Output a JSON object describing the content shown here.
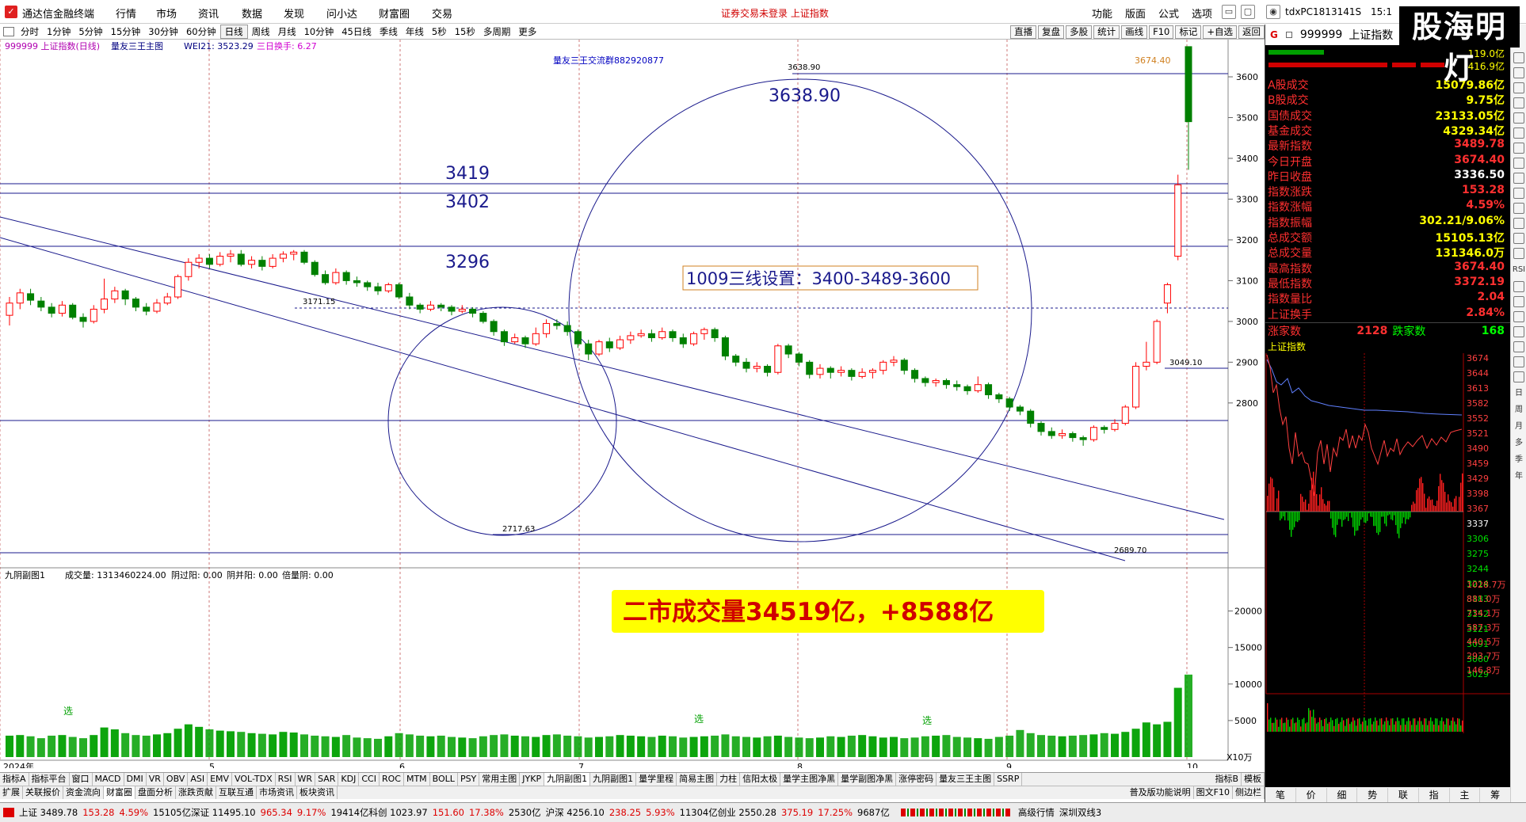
{
  "window": {
    "app_title": "通达信金融终端",
    "menus": [
      "行情",
      "市场",
      "资讯",
      "数据",
      "发现",
      "问小达",
      "财富圈",
      "交易"
    ],
    "notice": "证券交易未登录  上证指数",
    "right_menus": [
      "功能",
      "版面",
      "公式",
      "选项"
    ],
    "account": "tdxPC1813141S",
    "clock": "15:1",
    "brand": "股海明灯"
  },
  "periods": [
    "分时",
    "1分钟",
    "5分钟",
    "15分钟",
    "30分钟",
    "60分钟",
    "日线",
    "周线",
    "月线",
    "10分钟",
    "45日线",
    "季线",
    "年线",
    "5秒",
    "15秒",
    "多周期",
    "更多"
  ],
  "selected_period": "日线",
  "top_buttons": [
    "直播",
    "复盘",
    "多股",
    "统计",
    "画线",
    "F10",
    "标记",
    "+自选",
    "返回"
  ],
  "chart_header": {
    "code": "999999 上证指数(日线)",
    "indicator": "量友三王主图",
    "wei_label": "WEI21: 3523.29",
    "turnover_label": "三日换手: 6.27"
  },
  "chart_annotations": {
    "group_label": "量友三王交流群882920877",
    "circle_top": "3638.90",
    "big_top": "3638.90",
    "levels": [
      "3419",
      "3402",
      "3296"
    ],
    "setting_text": "1009三线设置：3400-3489-3600",
    "high_marker": "3674.40",
    "peak_left": "3171.15",
    "low_left": "2717.63",
    "low_right": "2689.70",
    "last_level": "3049.10",
    "volume_banner": "二市成交量34519亿，+8588亿",
    "sel_marks": [
      "选",
      "选",
      "选"
    ]
  },
  "volume_header": {
    "name": "九阴副图1",
    "volume": "成交量: 1313460224.00",
    "yin_yang": "阴过阳: 0.00",
    "yang_yin": "阴并阳: 0.00",
    "double_yin": "倍量阴: 0.00"
  },
  "x_axis": {
    "year": "2024年",
    "months": [
      "5",
      "6",
      "7",
      "8",
      "9",
      "10"
    ],
    "unit": "X10万"
  },
  "indicator_tabs": [
    "指标A",
    "指标平台",
    "窗口",
    "MACD",
    "DMI",
    "VR",
    "OBV",
    "ASI",
    "EMV",
    "VOL-TDX",
    "RSI",
    "WR",
    "SAR",
    "KDJ",
    "CCI",
    "ROC",
    "MTM",
    "BOLL",
    "PSY",
    "常用主图",
    "JYKP",
    "九阴副图1",
    "九阴副图1",
    "量学里程",
    "简易主图",
    "力柱",
    "信阳太极",
    "量学主图净黑",
    "量学副图净黑",
    "涨停密码",
    "量友三王主图",
    "SSRP"
  ],
  "indicator_tabs_right": [
    "指标B",
    "模板"
  ],
  "toolbar2": [
    "扩展",
    "关联报价",
    "资金流向",
    "财富圈",
    "盘面分析",
    "涨跌贡献",
    "互联互通",
    "市场资讯",
    "板块资讯"
  ],
  "toolbar2_right": [
    "普及版功能说明",
    "图文F10",
    "侧边栏"
  ],
  "status_items": [
    "上证 3489.78",
    "153.28",
    "4.59%",
    "15105亿深证 11495.10",
    "965.34",
    "9.17%",
    "19414亿科创 1023.97",
    "151.60",
    "17.38%",
    "2530亿",
    "沪深 4256.10",
    "238.25",
    "5.93%",
    "11304亿创业 2550.28",
    "375.19",
    "17.25%",
    "9687亿"
  ],
  "status_right": [
    "高级行情",
    "深圳双线3"
  ],
  "right_panel": {
    "header_letter": "G",
    "header_code": "999999",
    "header_name": "上证指数",
    "top_vals": [
      "119.0亿",
      "416.9亿"
    ],
    "rows": [
      {
        "k": "A股成交",
        "v": "15079.86亿",
        "c": "#ffff00"
      },
      {
        "k": "B股成交",
        "v": "9.75亿",
        "c": "#ffff00"
      },
      {
        "k": "国债成交",
        "v": "23133.05亿",
        "c": "#ffff00"
      },
      {
        "k": "基金成交",
        "v": "4329.34亿",
        "c": "#ffff00"
      },
      {
        "k": "最新指数",
        "v": "3489.78",
        "c": "#ff3030"
      },
      {
        "k": "今日开盘",
        "v": "3674.40",
        "c": "#ff3030"
      },
      {
        "k": "昨日收盘",
        "v": "3336.50",
        "c": "#ffffff"
      },
      {
        "k": "指数涨跌",
        "v": "153.28",
        "c": "#ff3030"
      },
      {
        "k": "指数涨幅",
        "v": "4.59%",
        "c": "#ff3030"
      },
      {
        "k": "指数振幅",
        "v": "302.21/9.06%",
        "c": "#ffff00"
      },
      {
        "k": "总成交额",
        "v": "15105.13亿",
        "c": "#ffff00"
      },
      {
        "k": "总成交量",
        "v": "131346.0万",
        "c": "#ffff00"
      },
      {
        "k": "最高指数",
        "v": "3674.40",
        "c": "#ff3030"
      },
      {
        "k": "最低指数",
        "v": "3372.19",
        "c": "#ff3030"
      },
      {
        "k": "指数量比",
        "v": "2.04",
        "c": "#ff3030"
      },
      {
        "k": "上证换手",
        "v": "2.84%",
        "c": "#ff3030"
      }
    ],
    "updown_label": "涨家数",
    "up_count": "2128",
    "down_label": "跌家数",
    "down_count": "168",
    "mini_title": "上证指数",
    "mini_ticks": [
      "3674",
      "3644",
      "3613",
      "3582",
      "3552",
      "3521",
      "3490",
      "3459",
      "3429",
      "3398",
      "3367",
      "3337",
      "3306",
      "3275",
      "3244",
      "3214",
      "3183",
      "3152",
      "3121",
      "3091",
      "3060",
      "3029"
    ],
    "mini_vol_ticks": [
      "1028.7万",
      "881.0万",
      "734.1万",
      "587.3万",
      "440.5万",
      "293.7万",
      "146.8万"
    ],
    "tabs": [
      "笔",
      "价",
      "细",
      "势",
      "联",
      "指",
      "主",
      "筹"
    ]
  },
  "side_buttons": [
    "RSI",
    "日",
    "周",
    "月",
    "多",
    "季",
    "年"
  ],
  "colors": {
    "up": "#ff0000",
    "down": "#008000",
    "line": "#1a1a8c",
    "mid": "#000080"
  },
  "chart_data": {
    "type": "candlestick",
    "title": "999999 上证指数(日线)",
    "y_ticks": [
      2800,
      2900,
      3000,
      3100,
      3200,
      3300,
      3400,
      3500,
      3600
    ],
    "ylim": [
      2660,
      3730
    ],
    "candles": [
      [
        3015,
        3045,
        2990,
        3060
      ],
      [
        3045,
        3070,
        3030,
        3080
      ],
      [
        3068,
        3052,
        3040,
        3080
      ],
      [
        3050,
        3035,
        3025,
        3060
      ],
      [
        3035,
        3020,
        3010,
        3045
      ],
      [
        3020,
        3040,
        3012,
        3050
      ],
      [
        3040,
        3010,
        3005,
        3045
      ],
      [
        3010,
        3000,
        2985,
        3020
      ],
      [
        3000,
        3030,
        2995,
        3040
      ],
      [
        3030,
        3055,
        3020,
        3105
      ],
      [
        3055,
        3075,
        3045,
        3085
      ],
      [
        3075,
        3055,
        3040,
        3080
      ],
      [
        3055,
        3035,
        3025,
        3060
      ],
      [
        3035,
        3025,
        3015,
        3045
      ],
      [
        3025,
        3045,
        3020,
        3055
      ],
      [
        3045,
        3060,
        3040,
        3070
      ],
      [
        3060,
        3110,
        3055,
        3115
      ],
      [
        3110,
        3145,
        3100,
        3155
      ],
      [
        3145,
        3155,
        3130,
        3165
      ],
      [
        3155,
        3140,
        3130,
        3165
      ],
      [
        3140,
        3160,
        3135,
        3170
      ],
      [
        3160,
        3165,
        3145,
        3175
      ],
      [
        3165,
        3140,
        3135,
        3175
      ],
      [
        3140,
        3150,
        3130,
        3160
      ],
      [
        3150,
        3135,
        3125,
        3160
      ],
      [
        3135,
        3155,
        3130,
        3165
      ],
      [
        3155,
        3165,
        3145,
        3172
      ],
      [
        3165,
        3170,
        3150,
        3175
      ],
      [
        3170,
        3145,
        3140,
        3175
      ],
      [
        3145,
        3115,
        3110,
        3150
      ],
      [
        3115,
        3095,
        3090,
        3125
      ],
      [
        3095,
        3120,
        3090,
        3130
      ],
      [
        3120,
        3100,
        3090,
        3125
      ],
      [
        3100,
        3095,
        3085,
        3110
      ],
      [
        3095,
        3085,
        3075,
        3100
      ],
      [
        3085,
        3075,
        3065,
        3095
      ],
      [
        3075,
        3090,
        3070,
        3095
      ],
      [
        3090,
        3060,
        3055,
        3095
      ],
      [
        3060,
        3040,
        3030,
        3070
      ],
      [
        3040,
        3030,
        3020,
        3045
      ],
      [
        3030,
        3040,
        3025,
        3050
      ],
      [
        3040,
        3035,
        3025,
        3045
      ],
      [
        3035,
        3025,
        3015,
        3040
      ],
      [
        3025,
        3030,
        3020,
        3040
      ],
      [
        3030,
        3020,
        3010,
        3035
      ],
      [
        3020,
        3000,
        2995,
        3025
      ],
      [
        3000,
        2975,
        2965,
        3005
      ],
      [
        2975,
        2950,
        2940,
        2980
      ],
      [
        2950,
        2960,
        2945,
        2970
      ],
      [
        2960,
        2945,
        2935,
        2965
      ],
      [
        2945,
        2970,
        2940,
        2985
      ],
      [
        2970,
        2995,
        2960,
        3005
      ],
      [
        2995,
        2990,
        2980,
        3005
      ],
      [
        2990,
        2975,
        2965,
        3000
      ],
      [
        2975,
        2945,
        2935,
        2980
      ],
      [
        2945,
        2920,
        2905,
        2955
      ],
      [
        2920,
        2950,
        2915,
        2955
      ],
      [
        2950,
        2935,
        2925,
        2960
      ],
      [
        2935,
        2955,
        2930,
        2965
      ],
      [
        2955,
        2965,
        2945,
        2975
      ],
      [
        2965,
        2970,
        2960,
        2980
      ],
      [
        2970,
        2960,
        2950,
        2980
      ],
      [
        2960,
        2975,
        2955,
        2985
      ],
      [
        2975,
        2960,
        2950,
        2980
      ],
      [
        2960,
        2945,
        2935,
        2970
      ],
      [
        2945,
        2970,
        2940,
        2975
      ],
      [
        2970,
        2980,
        2955,
        2985
      ],
      [
        2980,
        2960,
        2950,
        2985
      ],
      [
        2960,
        2915,
        2905,
        2965
      ],
      [
        2915,
        2900,
        2890,
        2920
      ],
      [
        2900,
        2885,
        2875,
        2910
      ],
      [
        2885,
        2890,
        2875,
        2900
      ],
      [
        2890,
        2875,
        2865,
        2895
      ],
      [
        2875,
        2940,
        2870,
        2945
      ],
      [
        2940,
        2920,
        2910,
        2945
      ],
      [
        2920,
        2900,
        2890,
        2925
      ],
      [
        2900,
        2870,
        2860,
        2905
      ],
      [
        2870,
        2885,
        2860,
        2895
      ],
      [
        2885,
        2875,
        2860,
        2890
      ],
      [
        2875,
        2880,
        2865,
        2890
      ],
      [
        2880,
        2865,
        2855,
        2885
      ],
      [
        2865,
        2875,
        2860,
        2885
      ],
      [
        2875,
        2880,
        2860,
        2885
      ],
      [
        2880,
        2900,
        2870,
        2905
      ],
      [
        2900,
        2905,
        2890,
        2915
      ],
      [
        2905,
        2880,
        2870,
        2910
      ],
      [
        2880,
        2860,
        2850,
        2885
      ],
      [
        2860,
        2850,
        2840,
        2865
      ],
      [
        2850,
        2855,
        2840,
        2860
      ],
      [
        2855,
        2845,
        2835,
        2860
      ],
      [
        2845,
        2840,
        2830,
        2855
      ],
      [
        2840,
        2830,
        2820,
        2845
      ],
      [
        2830,
        2845,
        2825,
        2865
      ],
      [
        2845,
        2820,
        2810,
        2850
      ],
      [
        2820,
        2810,
        2800,
        2825
      ],
      [
        2810,
        2790,
        2780,
        2815
      ],
      [
        2790,
        2780,
        2770,
        2795
      ],
      [
        2780,
        2750,
        2740,
        2785
      ],
      [
        2750,
        2730,
        2720,
        2755
      ],
      [
        2730,
        2720,
        2712,
        2740
      ],
      [
        2720,
        2725,
        2712,
        2735
      ],
      [
        2725,
        2715,
        2705,
        2730
      ],
      [
        2715,
        2710,
        2695,
        2720
      ],
      [
        2710,
        2740,
        2705,
        2745
      ],
      [
        2740,
        2735,
        2725,
        2745
      ],
      [
        2735,
        2750,
        2730,
        2760
      ],
      [
        2750,
        2790,
        2745,
        2795
      ],
      [
        2790,
        2890,
        2785,
        2900
      ],
      [
        2890,
        2900,
        2880,
        2950
      ],
      [
        2900,
        3000,
        2895,
        3005
      ],
      [
        3045,
        3090,
        3020,
        3095
      ],
      [
        3160,
        3335,
        3150,
        3360
      ],
      [
        3674,
        3490,
        3372,
        3674
      ]
    ],
    "volumes": [
      34,
      35,
      33,
      30,
      34,
      35,
      32,
      30,
      35,
      47,
      44,
      38,
      35,
      34,
      36,
      38,
      45,
      52,
      48,
      44,
      42,
      41,
      40,
      38,
      37,
      36,
      40,
      39,
      36,
      34,
      33,
      32,
      35,
      31,
      30,
      29,
      33,
      38,
      36,
      34,
      33,
      34,
      32,
      31,
      30,
      33,
      35,
      36,
      34,
      33,
      32,
      35,
      36,
      34,
      33,
      31,
      32,
      33,
      35,
      34,
      33,
      32,
      34,
      33,
      31,
      32,
      33,
      34,
      36,
      33,
      32,
      31,
      33,
      34,
      32,
      31,
      30,
      31,
      33,
      32,
      34,
      35,
      33,
      31,
      32,
      30,
      31,
      33,
      34,
      35,
      32,
      31,
      30,
      29,
      32,
      34,
      43,
      38,
      35,
      34,
      33,
      34,
      35,
      36,
      38,
      37,
      40,
      45,
      55,
      52,
      56,
      110,
      131
    ],
    "vol_ticks": [
      5000,
      10000,
      15000,
      20000
    ]
  }
}
